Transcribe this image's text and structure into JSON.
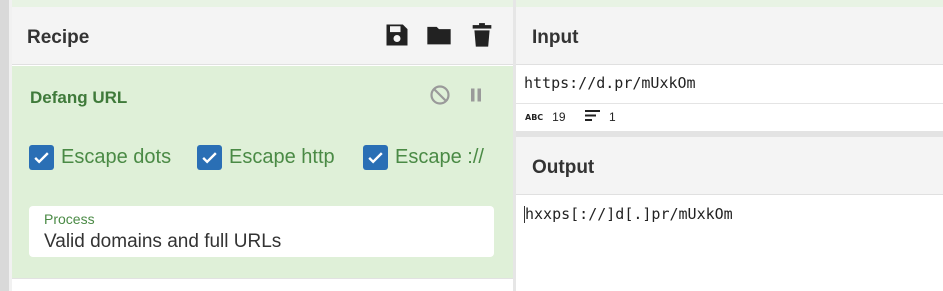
{
  "recipe": {
    "title": "Recipe",
    "icons": [
      "save-icon",
      "folder-icon",
      "trash-icon"
    ]
  },
  "operation": {
    "title": "Defang URL",
    "controls": [
      "disable-icon",
      "pause-icon"
    ],
    "checkboxes": [
      {
        "label": "Escape dots",
        "checked": true
      },
      {
        "label": "Escape http",
        "checked": true
      },
      {
        "label": "Escape ://",
        "checked": true
      }
    ],
    "process": {
      "label": "Process",
      "value": "Valid domains and full URLs"
    }
  },
  "input": {
    "title": "Input",
    "text": "https://d.pr/mUxkOm",
    "char_count": "19",
    "line_count": "1",
    "char_icon_text": "ABC"
  },
  "output": {
    "title": "Output",
    "text": "hxxps[://]d[.]pr/mUxkOm"
  },
  "colors": {
    "accent_blue": "#2a6fb5",
    "operation_bg": "#dff0d8",
    "operation_text": "#3f7a3a"
  }
}
